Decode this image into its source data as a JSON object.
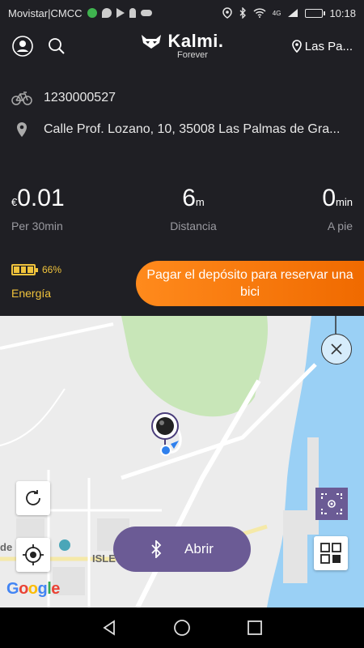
{
  "status": {
    "carrier": "Movistar|CMCC",
    "network": "4G",
    "time": "10:18"
  },
  "header": {
    "logo": "Kalmi.",
    "logo_sub": "Forever",
    "location": "Las Pa..."
  },
  "bike": {
    "id": "1230000527",
    "address": "Calle Prof. Lozano, 10, 35008 Las Palmas de Gra..."
  },
  "stats": {
    "price": {
      "prefix": "€",
      "value": "0.01",
      "label": "Per 30min"
    },
    "distance": {
      "value": "6",
      "unit": "m",
      "label": "Distancia"
    },
    "time": {
      "value": "0",
      "unit": "min",
      "label": "A pie"
    }
  },
  "energy": {
    "percent": "66%",
    "level": 0.66,
    "label": "Energía"
  },
  "deposit_button": "Pagar el depósito para reservar una bici",
  "map": {
    "open_button": "Abrir",
    "google_logo": "Google",
    "labels": {
      "isleta": "ISLE",
      "de": "de"
    }
  },
  "colors": {
    "background": "#1f1f24",
    "accent_orange": "#f07a10",
    "energy_yellow": "#f0c33c",
    "purple": "#6b5b95",
    "map_water": "#9ad0f5",
    "map_green": "#c8e6b8"
  }
}
